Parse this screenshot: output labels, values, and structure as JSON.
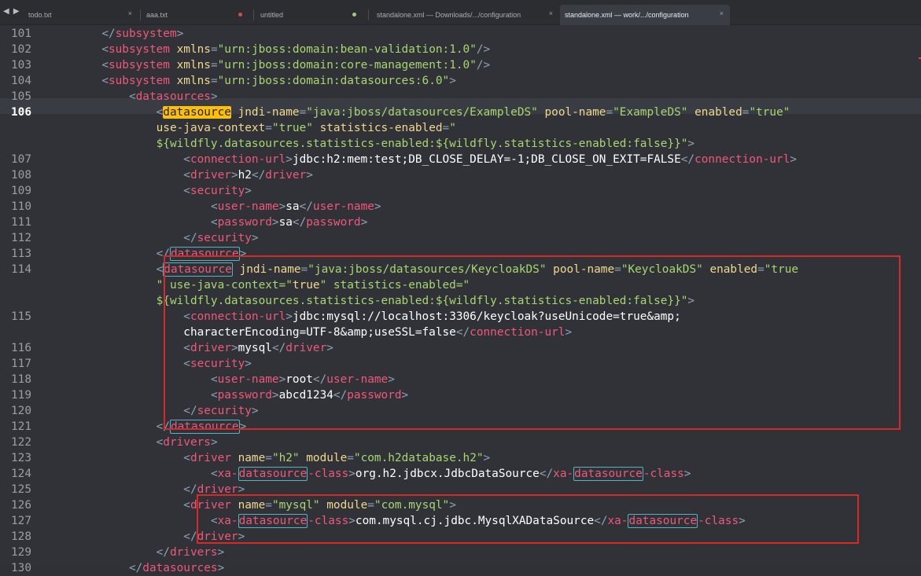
{
  "tabs": [
    {
      "label": "todo.txt",
      "marker": "×",
      "active": false
    },
    {
      "label": "aaa.txt",
      "marker": "●",
      "marker_color": "#d84a4a",
      "active": false
    },
    {
      "label": "untitled",
      "marker": "●",
      "marker_color": "#a6c77a",
      "active": false
    },
    {
      "label": "standalone.xml — Downloads/.../configuration",
      "marker": "×",
      "active": false
    },
    {
      "label": "standalone.xml — work/.../configuration",
      "marker": "×",
      "active": true
    }
  ],
  "nav": {
    "arrows": "◀ ▶"
  },
  "editor": {
    "active_line": "106",
    "lines": [
      {
        "n": "101",
        "text": "        </subsystem>"
      },
      {
        "n": "102",
        "text": "        <subsystem xmlns=\"urn:jboss:domain:bean-validation:1.0\"/>"
      },
      {
        "n": "103",
        "text": "        <subsystem xmlns=\"urn:jboss:domain:core-management:1.0\"/>"
      },
      {
        "n": "104",
        "text": "        <subsystem xmlns=\"urn:jboss:domain:datasources:6.0\">"
      },
      {
        "n": "105",
        "text": "            <datasources>"
      },
      {
        "n": "106",
        "text": "                <datasource jndi-name=\"java:jboss/datasources/ExampleDS\" pool-name=\"ExampleDS\" enabled=\"true\""
      },
      {
        "n": "",
        "text": "                use-java-context=\"true\" statistics-enabled=\""
      },
      {
        "n": "",
        "text": "                ${wildfly.datasources.statistics-enabled:${wildfly.statistics-enabled:false}}\">"
      },
      {
        "n": "107",
        "text": "                    <connection-url>jdbc:h2:mem:test;DB_CLOSE_DELAY=-1;DB_CLOSE_ON_EXIT=FALSE</connection-url>"
      },
      {
        "n": "108",
        "text": "                    <driver>h2</driver>"
      },
      {
        "n": "109",
        "text": "                    <security>"
      },
      {
        "n": "110",
        "text": "                        <user-name>sa</user-name>"
      },
      {
        "n": "111",
        "text": "                        <password>sa</password>"
      },
      {
        "n": "112",
        "text": "                    </security>"
      },
      {
        "n": "113",
        "text": "                </datasource>"
      },
      {
        "n": "114",
        "text": "                <datasource jndi-name=\"java:jboss/datasources/KeycloakDS\" pool-name=\"KeycloakDS\" enabled=\"true"
      },
      {
        "n": "",
        "text": "                \" use-java-context=\"true\" statistics-enabled=\""
      },
      {
        "n": "",
        "text": "                ${wildfly.datasources.statistics-enabled:${wildfly.statistics-enabled:false}}\">"
      },
      {
        "n": "115",
        "text": "                    <connection-url>jdbc:mysql://localhost:3306/keycloak?useUnicode=true&amp;"
      },
      {
        "n": "",
        "text": "                    characterEncoding=UTF-8&amp;useSSL=false</connection-url>"
      },
      {
        "n": "116",
        "text": "                    <driver>mysql</driver>"
      },
      {
        "n": "117",
        "text": "                    <security>"
      },
      {
        "n": "118",
        "text": "                        <user-name>root</user-name>"
      },
      {
        "n": "119",
        "text": "                        <password>abcd1234</password>"
      },
      {
        "n": "120",
        "text": "                    </security>"
      },
      {
        "n": "121",
        "text": "                </datasource>"
      },
      {
        "n": "122",
        "text": "                <drivers>"
      },
      {
        "n": "123",
        "text": "                    <driver name=\"h2\" module=\"com.h2database.h2\">"
      },
      {
        "n": "124",
        "text": "                        <xa-datasource-class>org.h2.jdbcx.JdbcDataSource</xa-datasource-class>"
      },
      {
        "n": "125",
        "text": "                    </driver>"
      },
      {
        "n": "126",
        "text": "                    <driver name=\"mysql\" module=\"com.mysql\">"
      },
      {
        "n": "127",
        "text": "                        <xa-datasource-class>com.mysql.cj.jdbc.MysqlXADataSource</xa-datasource-class>"
      },
      {
        "n": "128",
        "text": "                    </driver>"
      },
      {
        "n": "129",
        "text": "                </drivers>"
      },
      {
        "n": "130",
        "text": "            </datasources>"
      }
    ]
  },
  "annotations": {
    "highlight_color": "#d42a2a"
  },
  "colors": {
    "background": "#303238",
    "tag": "#f2577a",
    "attribute": "#f2d88c",
    "string": "#a8d66f",
    "punctuation": "#8fa2b5",
    "text": "#ffffff",
    "search_match": "#ffc000"
  }
}
